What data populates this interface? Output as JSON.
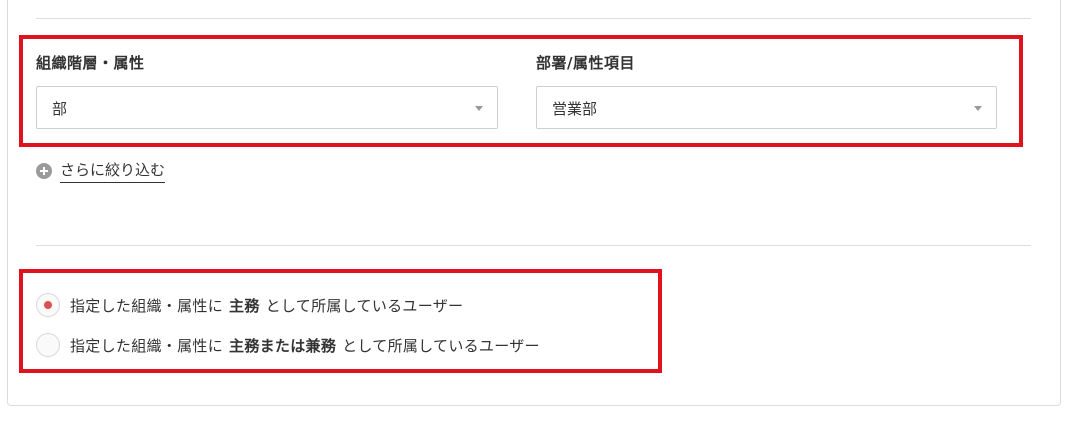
{
  "filters": {
    "hierarchy": {
      "label": "組織階層・属性",
      "value": "部"
    },
    "department": {
      "label": "部署/属性項目",
      "value": "営業部"
    }
  },
  "narrow_link": {
    "label": "さらに絞り込む",
    "icon": "plus-circle-icon"
  },
  "radio_options": [
    {
      "prefix": "指定した組織・属性に",
      "bold": "主務",
      "suffix": "として所属しているユーザー",
      "checked": true
    },
    {
      "prefix": "指定した組織・属性に",
      "bold": "主務または兼務",
      "suffix": "として所属しているユーザー",
      "checked": false
    }
  ],
  "colors": {
    "highlight": "#e0121e",
    "radio_checked": "#d9534f"
  }
}
